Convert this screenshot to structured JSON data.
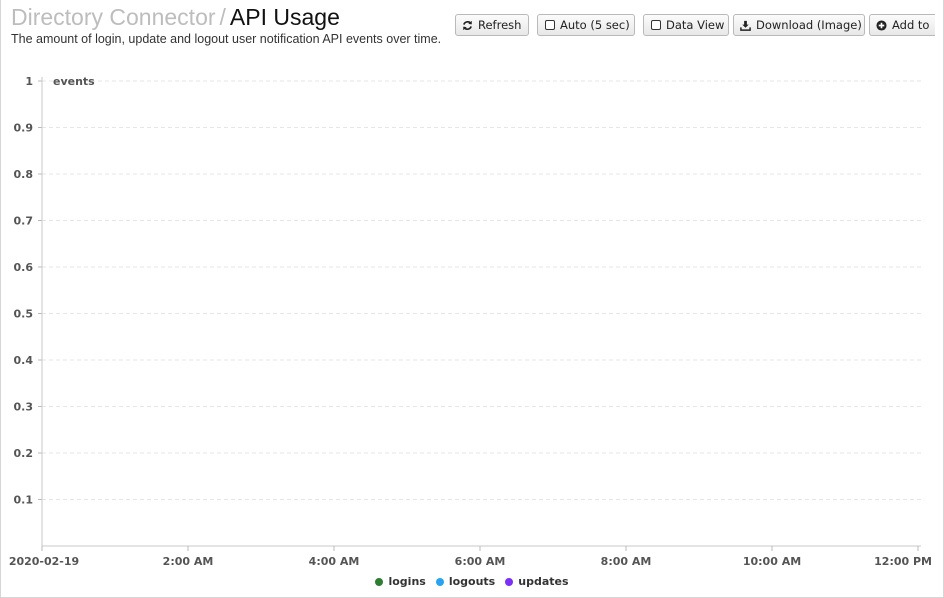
{
  "header": {
    "breadcrumb_parent": "Directory Connector",
    "separator": "/",
    "title": "API Usage",
    "subtitle": "The amount of login, update and logout user notification API events over time."
  },
  "toolbar": {
    "refresh_label": "Refresh",
    "auto_label": "Auto (5 sec)",
    "data_view_label": "Data View",
    "download_label": "Download (Image)",
    "add_to_label": "Add to"
  },
  "icons": {
    "refresh": "refresh-icon",
    "auto": "checkbox-icon",
    "data_view": "checkbox-icon",
    "download": "download-icon",
    "add_to": "plus-circle-icon"
  },
  "chart_data": {
    "type": "line",
    "ylabel": "events",
    "ylim": [
      0,
      1
    ],
    "y_ticks": [
      "0.1",
      "0.2",
      "0.3",
      "0.4",
      "0.5",
      "0.6",
      "0.7",
      "0.8",
      "0.9",
      "1"
    ],
    "x_ticks": [
      "2020-02-19",
      "2:00 AM",
      "4:00 AM",
      "6:00 AM",
      "8:00 AM",
      "10:00 AM",
      "12:00 PM"
    ],
    "grid": true,
    "legend_position": "bottom",
    "series": [
      {
        "name": "logins",
        "color": "#2e7d32",
        "values": []
      },
      {
        "name": "logouts",
        "color": "#29a3f0",
        "values": []
      },
      {
        "name": "updates",
        "color": "#7b2ff7",
        "values": []
      }
    ]
  }
}
